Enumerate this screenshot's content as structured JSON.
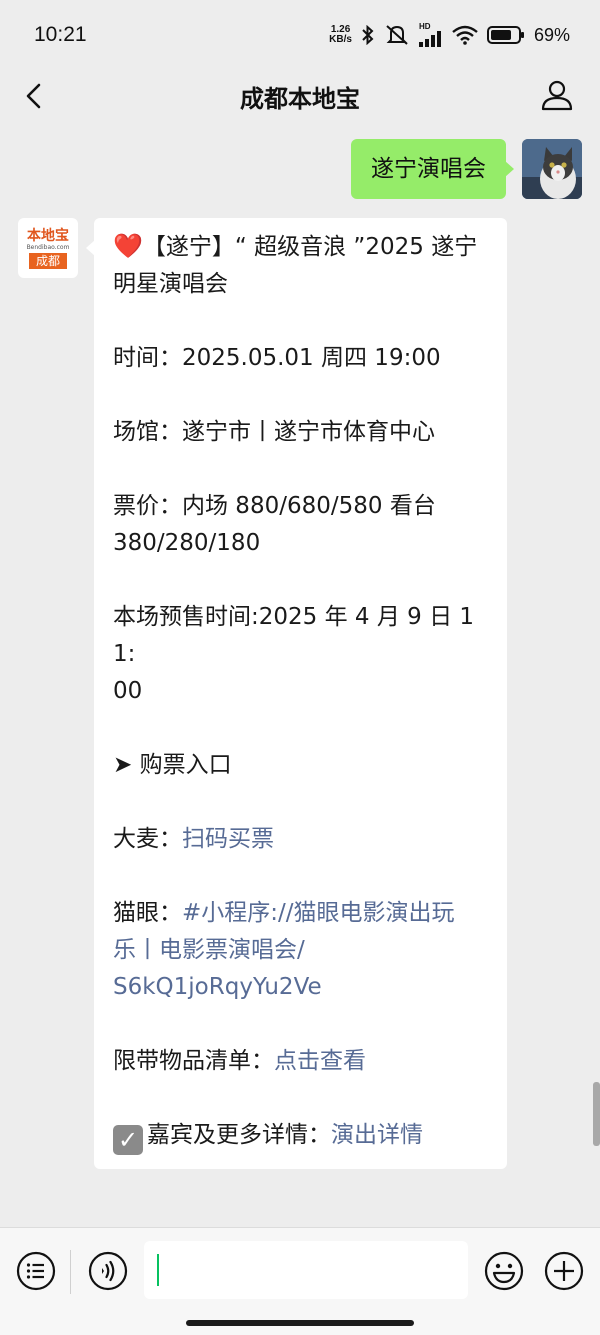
{
  "status_bar": {
    "time": "10:21",
    "net_speed_value": "1.26",
    "net_speed_unit": "KB/s",
    "network_label": "HD",
    "battery_percent": "69%"
  },
  "nav": {
    "title": "成都本地宝"
  },
  "outgoing_message": {
    "text": "遂宁演唱会"
  },
  "bot_avatar": {
    "logo_top": "本地宝",
    "logo_mid": "Bendibao.com",
    "logo_bottom": "成都"
  },
  "incoming_message": {
    "title_line1": "【遂宁】“ 超级音浪 ”2025 遂宁",
    "title_line2": "明星演唱会",
    "time_line": "时间：2025.05.01 周四 19:00",
    "venue_line": "场馆：遂宁市丨遂宁市体育中心",
    "price_line1": "票价：内场 880/680/580 看台",
    "price_line2": "380/280/180",
    "presale_line1": "本场预售时间:2025 年 4 月 9 日 11:",
    "presale_line2": "00",
    "ticket_entry": "➤ 购票入口",
    "damai_label": "大麦：",
    "damai_link": "扫码买票",
    "maoyan_label": "猫眼：",
    "maoyan_link_line1": "#小程序://猫眼电影演出玩",
    "maoyan_link_line2": "乐丨电影票演唱会/",
    "maoyan_link_line3": "S6kQ1joRqyYu2Ve",
    "items_label": "限带物品清单：",
    "items_link": "点击查看",
    "details_label": "嘉宾及更多详情：",
    "details_link": "演出详情"
  },
  "colors": {
    "background": "#ededed",
    "outgoing_bubble": "#95ec69",
    "link": "#576b95",
    "cursor": "#07c160"
  },
  "icons": {
    "back": "chevron-left-icon",
    "profile": "person-icon",
    "menu": "list-icon",
    "voice": "voice-icon",
    "emoji": "smiley-icon",
    "plus": "plus-icon"
  }
}
